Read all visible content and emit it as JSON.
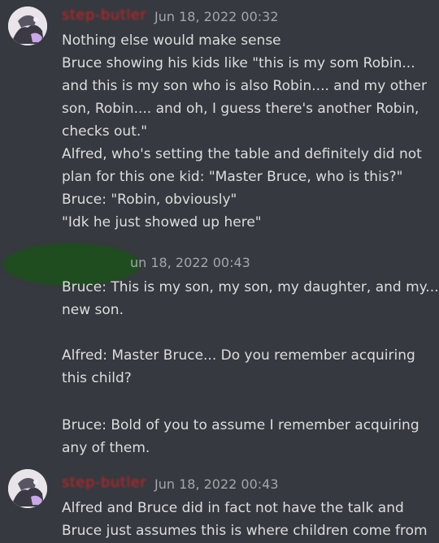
{
  "colors": {
    "background": "#36393f",
    "text": "#dcddde",
    "timestamp": "#a3a6aa",
    "username": "#c3262b",
    "redaction": "#1f4d1f"
  },
  "messages": [
    {
      "username": "step-butler",
      "timestamp": "Jun 18, 2022 00:32",
      "lines": [
        "Nothing else would make sense",
        "Bruce showing his kids like \"this is my som Robin...",
        "and this is my son who is also Robin.... and my other",
        "son, Robin.... and oh, I guess there's another Robin,",
        "checks out.\"",
        "Alfred, who's setting the table and definitely did not",
        "plan for this one kid: \"Master Bruce, who is this?\"",
        "Bruce: \"Robin, obviously\"",
        "\"Idk he just showed up here\""
      ]
    },
    {
      "username": "",
      "timestamp": "un 18, 2022 00:43",
      "lines": [
        "Bruce: This is my son, my son, my daughter, and my...",
        "new son.",
        "",
        "Alfred: Master Bruce... Do you remember acquiring",
        "this child?",
        "",
        "Bruce: Bold of you to assume I remember acquiring",
        "any of them."
      ]
    },
    {
      "username": "step-butler",
      "timestamp": "Jun 18, 2022 00:43",
      "lines": [
        "Alfred and Bruce did in fact not have the talk and",
        "Bruce just assumes this is where children come from"
      ]
    }
  ]
}
